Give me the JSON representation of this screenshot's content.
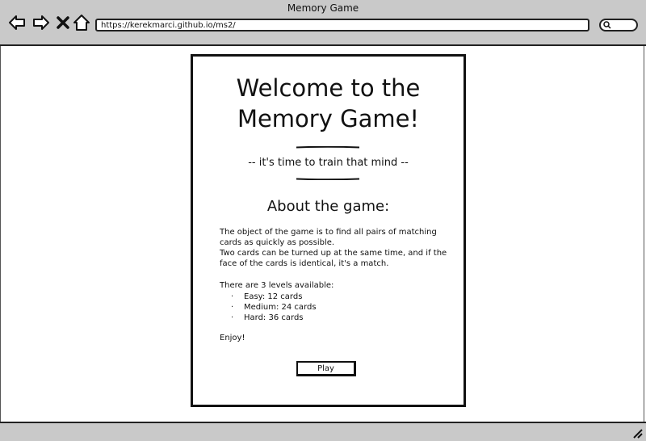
{
  "window": {
    "title": "Memory Game"
  },
  "browser": {
    "url": "https://kerekmarci.github.io/ms2/"
  },
  "page": {
    "heading_line1": "Welcome to the",
    "heading_line2": "Memory Game!",
    "tagline": "-- it's time to train that mind --",
    "about_heading": "About the game:",
    "description_line1": "The object of the game is to find all pairs of matching cards as quickly as possible.",
    "description_line2": "Two cards can be turned up at the same time, and if the face of the cards is identical, it's a match.",
    "levels_intro": "There are 3 levels available:",
    "levels": [
      "Easy: 12 cards",
      "Medium: 24 cards",
      "Hard: 36 cards"
    ],
    "closing": "Enjoy!",
    "play_label": "Play"
  }
}
